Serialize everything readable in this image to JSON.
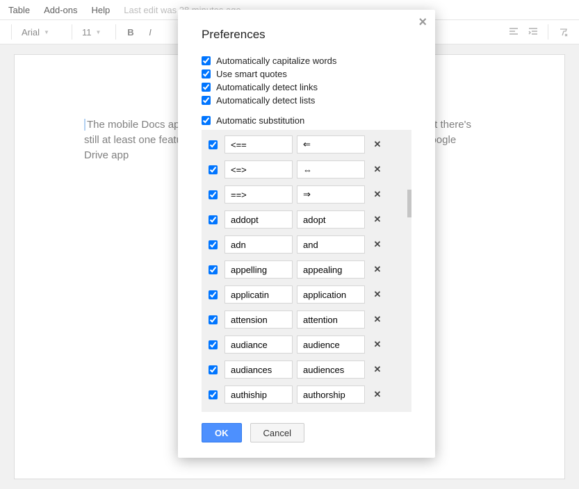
{
  "menubar": {
    "items": [
      "Table",
      "Add-ons",
      "Help"
    ],
    "last_edit": "Last edit was 28 minutes ago"
  },
  "toolbar": {
    "font_name": "Arial",
    "font_size": "11",
    "bold": "B",
    "italic": "I"
  },
  "doc": {
    "line1": "The mobile Docs app",
    "line1_cont": "arts, but there's",
    "line2": "still at least one featu",
    "line2_cont": "n the Google",
    "line3": "Drive app"
  },
  "dialog": {
    "title": "Preferences",
    "checks": [
      {
        "label": "Automatically capitalize words",
        "checked": true
      },
      {
        "label": "Use smart quotes",
        "checked": true
      },
      {
        "label": "Automatically detect links",
        "checked": true
      },
      {
        "label": "Automatically detect lists",
        "checked": true
      }
    ],
    "auto_sub": {
      "label": "Automatic substitution",
      "checked": true
    },
    "subs": [
      {
        "checked": true,
        "from": "<==",
        "to": "⇐"
      },
      {
        "checked": true,
        "from": "<=>",
        "to": "⇔"
      },
      {
        "checked": true,
        "from": "==>",
        "to": "⇒"
      },
      {
        "checked": true,
        "from": "addopt",
        "to": "adopt"
      },
      {
        "checked": true,
        "from": "adn",
        "to": "and"
      },
      {
        "checked": true,
        "from": "appelling",
        "to": "appealing"
      },
      {
        "checked": true,
        "from": "applicatin",
        "to": "application"
      },
      {
        "checked": true,
        "from": "attension",
        "to": "attention"
      },
      {
        "checked": true,
        "from": "audiance",
        "to": "audience"
      },
      {
        "checked": true,
        "from": "audiances",
        "to": "audiences"
      },
      {
        "checked": true,
        "from": "authiship",
        "to": "authorship"
      }
    ],
    "ok": "OK",
    "cancel": "Cancel"
  }
}
